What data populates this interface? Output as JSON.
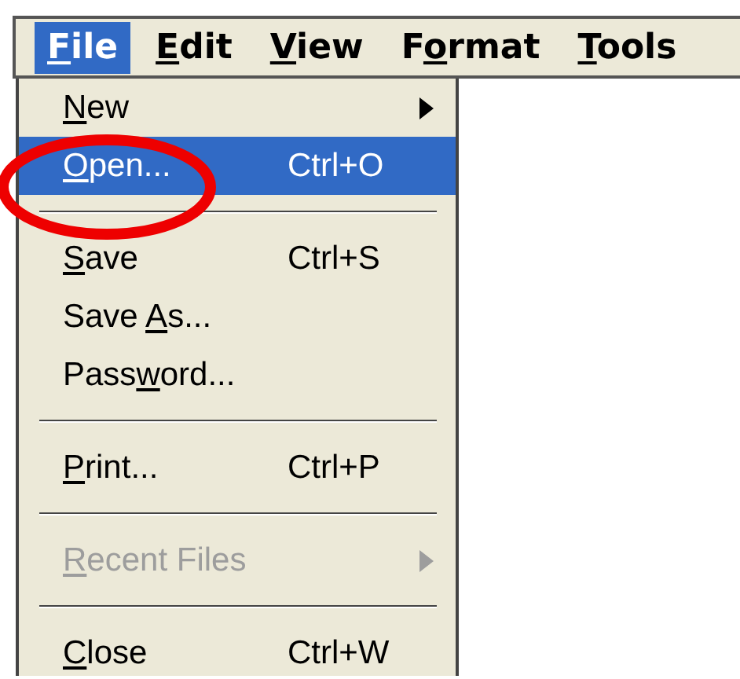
{
  "menu_bar": [
    {
      "label": [
        {
          "text": "F",
          "underlined": true
        },
        {
          "text": "ile",
          "underlined": false
        }
      ],
      "selected": true
    },
    {
      "label": [
        {
          "text": "E",
          "underlined": true
        },
        {
          "text": "dit",
          "underlined": false
        }
      ],
      "selected": false
    },
    {
      "label": [
        {
          "text": "V",
          "underlined": true
        },
        {
          "text": "iew",
          "underlined": false
        }
      ],
      "selected": false
    },
    {
      "label": [
        {
          "text": "F",
          "underlined": false
        },
        {
          "text": "o",
          "underlined": true
        },
        {
          "text": "rmat",
          "underlined": false
        }
      ],
      "selected": false
    },
    {
      "label": [
        {
          "text": "T",
          "underlined": true
        },
        {
          "text": "ools",
          "underlined": false
        }
      ],
      "selected": false
    }
  ],
  "file_menu": [
    {
      "kind": "item",
      "label": [
        {
          "text": "N",
          "underlined": true
        },
        {
          "text": "ew",
          "underlined": false
        }
      ],
      "submenu": true,
      "selected": false,
      "disabled": false,
      "circled": false
    },
    {
      "kind": "item",
      "label": [
        {
          "text": "O",
          "underlined": true
        },
        {
          "text": "pen...",
          "underlined": false
        }
      ],
      "shortcut": "Ctrl+O",
      "selected": true,
      "disabled": false,
      "circled": true
    },
    {
      "kind": "separator"
    },
    {
      "kind": "item",
      "label": [
        {
          "text": "S",
          "underlined": true
        },
        {
          "text": "ave",
          "underlined": false
        }
      ],
      "shortcut": "Ctrl+S",
      "selected": false,
      "disabled": false,
      "circled": false
    },
    {
      "kind": "item",
      "label": [
        {
          "text": "Save ",
          "underlined": false
        },
        {
          "text": "A",
          "underlined": true
        },
        {
          "text": "s...",
          "underlined": false
        }
      ],
      "selected": false,
      "disabled": false,
      "circled": false
    },
    {
      "kind": "item",
      "label": [
        {
          "text": "Pass",
          "underlined": false
        },
        {
          "text": "w",
          "underlined": true
        },
        {
          "text": "ord...",
          "underlined": false
        }
      ],
      "selected": false,
      "disabled": false,
      "circled": false
    },
    {
      "kind": "separator"
    },
    {
      "kind": "item",
      "label": [
        {
          "text": "P",
          "underlined": true
        },
        {
          "text": "rint...",
          "underlined": false
        }
      ],
      "shortcut": "Ctrl+P",
      "selected": false,
      "disabled": false,
      "circled": false
    },
    {
      "kind": "separator"
    },
    {
      "kind": "item",
      "label": [
        {
          "text": "R",
          "underlined": true
        },
        {
          "text": "ecent Files",
          "underlined": false
        }
      ],
      "submenu": true,
      "selected": false,
      "disabled": true,
      "circled": false
    },
    {
      "kind": "separator"
    },
    {
      "kind": "item",
      "label": [
        {
          "text": "C",
          "underlined": true
        },
        {
          "text": "lose",
          "underlined": false
        }
      ],
      "shortcut": "Ctrl+W",
      "selected": false,
      "disabled": false,
      "circled": false
    }
  ]
}
